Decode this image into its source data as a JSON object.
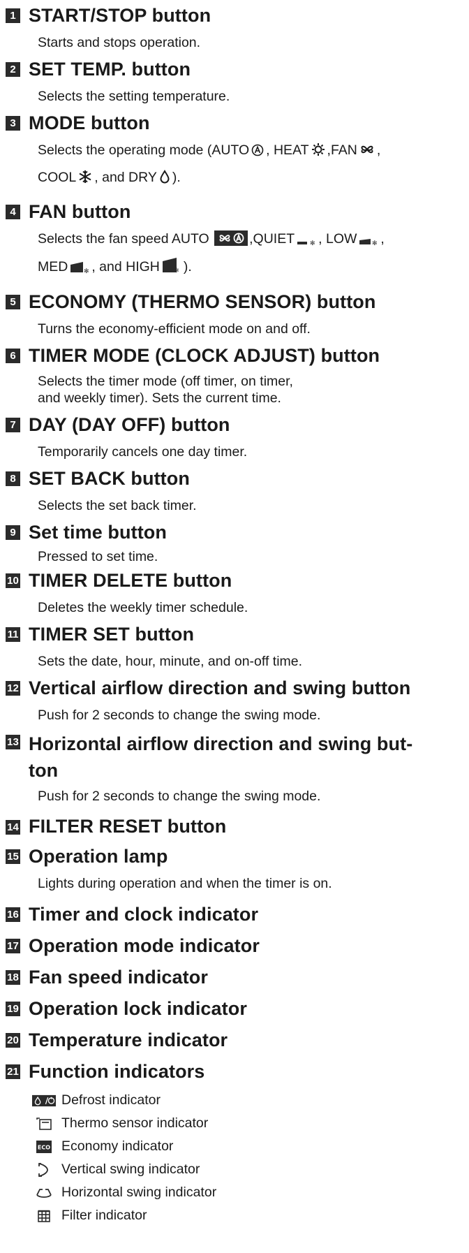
{
  "items": [
    {
      "num": "1",
      "title": "START/STOP button",
      "desc": "Starts and stops operation."
    },
    {
      "num": "2",
      "title": "SET TEMP. button",
      "desc": "Selects the setting temperature."
    },
    {
      "num": "3",
      "title": "MODE button",
      "mode_desc": {
        "prefix": "Selects the operating mode (",
        "auto": "AUTO",
        "heat": ", HEAT",
        "fan": ",FAN",
        "sep": ",",
        "cool": "COOL",
        "dry": ", and DRY",
        "end": ")."
      }
    },
    {
      "num": "4",
      "title": "FAN button",
      "fan_desc": {
        "prefix": "Selects the fan speed AUTO",
        "quiet": ",QUIET",
        "low": ", LOW",
        "sep": ",",
        "med": "MED",
        "high": ", and HIGH",
        "end": ")."
      }
    },
    {
      "num": "5",
      "title": "ECONOMY (THERMO SENSOR) button",
      "desc": "Turns the economy-efficient mode on and off."
    },
    {
      "num": "6",
      "title": "TIMER MODE (CLOCK ADJUST) button",
      "desc": "Selects the timer mode (off timer, on timer, and weekly timer). Sets the current time."
    },
    {
      "num": "7",
      "title": "DAY (DAY OFF) button",
      "desc": "Temporarily cancels one day timer."
    },
    {
      "num": "8",
      "title": "SET BACK button",
      "desc": "Selects the set back timer."
    },
    {
      "num": "9",
      "title": "Set time button",
      "desc": "Pressed to set time."
    },
    {
      "num": "10",
      "title": "TIMER DELETE button",
      "desc": "Deletes the weekly timer schedule."
    },
    {
      "num": "11",
      "title": "TIMER SET button",
      "desc": "Sets the date, hour, minute, and on-off time."
    },
    {
      "num": "12",
      "title": "Vertical airflow direction and swing button",
      "desc": "Push for 2 seconds to change the swing mode."
    },
    {
      "num": "13",
      "title": "Horizontal airflow direction and swing but-ton",
      "desc": "Push for 2 seconds to change the swing mode."
    },
    {
      "num": "14",
      "title": "FILTER RESET button"
    },
    {
      "num": "15",
      "title": "Operation lamp",
      "desc": "Lights during operation and when the timer is on."
    },
    {
      "num": "16",
      "title": "Timer and clock indicator"
    },
    {
      "num": "17",
      "title": "Operation mode indicator"
    },
    {
      "num": "18",
      "title": "Fan speed indicator"
    },
    {
      "num": "19",
      "title": "Operation lock indicator"
    },
    {
      "num": "20",
      "title": "Temperature indicator"
    },
    {
      "num": "21",
      "title": "Function indicators"
    }
  ],
  "function_indicators": [
    {
      "icon": "defrost-icon",
      "label": "Defrost indicator"
    },
    {
      "icon": "thermo-sensor-icon",
      "label": "Thermo sensor indicator"
    },
    {
      "icon": "economy-icon",
      "label": "Economy indicator"
    },
    {
      "icon": "vertical-swing-icon",
      "label": "Vertical swing indicator"
    },
    {
      "icon": "horizontal-swing-icon",
      "label": "Horizontal swing indicator"
    },
    {
      "icon": "filter-icon",
      "label": "Filter indicator"
    }
  ]
}
